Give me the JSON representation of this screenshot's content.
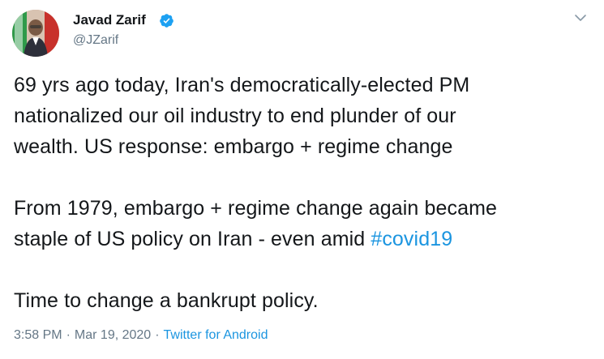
{
  "author": {
    "name": "Javad Zarif",
    "handle": "@JZarif",
    "verified_icon": "verified-badge-icon",
    "avatar_icon": "profile-photo"
  },
  "menu": {
    "icon": "chevron-down-icon"
  },
  "tweet": {
    "paragraph1": [
      "69 yrs ago today, Iran's democratically-elected PM",
      "nationalized our oil industry to end plunder of our",
      "wealth. US response: embargo + regime change"
    ],
    "paragraph2": [
      "From 1979, embargo + regime change again became",
      "staple of US policy on Iran - even amid "
    ],
    "hashtag": "#covid19",
    "paragraph3": [
      "Time to change a bankrupt policy."
    ]
  },
  "meta": {
    "time": "3:58 PM",
    "separator": "·",
    "date": "Mar 19, 2020",
    "source": "Twitter for Android"
  },
  "colors": {
    "text": "#14171a",
    "secondary": "#657786",
    "link": "#1b95e0",
    "verified": "#1da1f2"
  }
}
